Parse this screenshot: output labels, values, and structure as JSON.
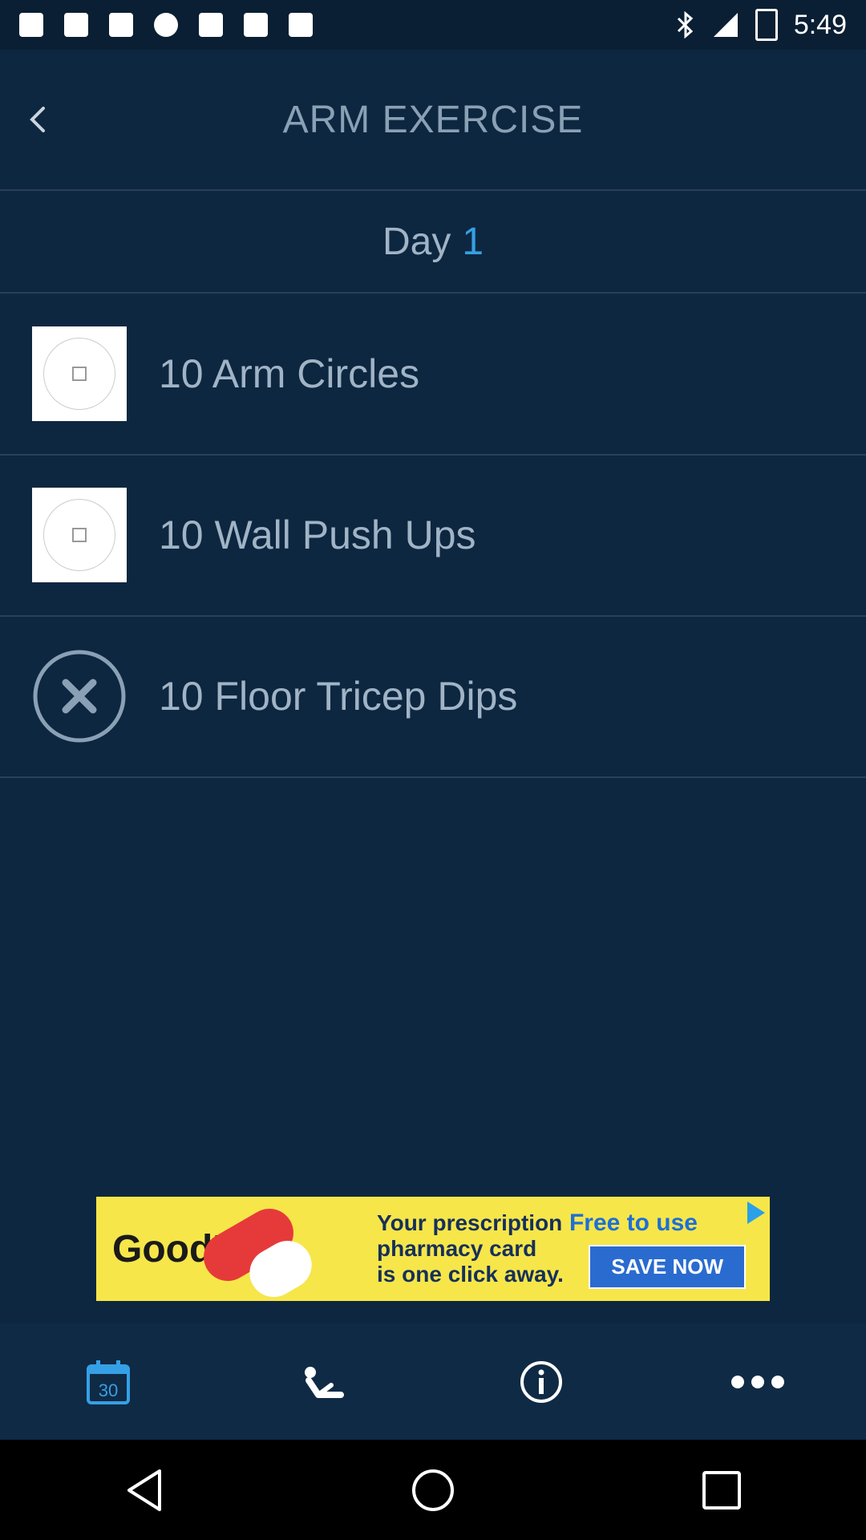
{
  "status_bar": {
    "time": "5:49"
  },
  "header": {
    "title": "ARM EXERCISE"
  },
  "day": {
    "label": "Day",
    "number": "1"
  },
  "exercises": [
    {
      "label": "10 Arm Circles",
      "status": "thumbnail"
    },
    {
      "label": "10 Wall Push Ups",
      "status": "thumbnail"
    },
    {
      "label": "10 Floor Tricep Dips",
      "status": "skipped"
    }
  ],
  "ad": {
    "brand": "GoodRx",
    "text_line1": "Your prescription",
    "text_line2": "pharmacy card",
    "text_line3": "is one click away.",
    "free": "Free to use",
    "cta": "SAVE NOW"
  },
  "bottom_nav": {
    "calendar_number": "30",
    "items": [
      "calendar-icon",
      "exercise-icon",
      "info-icon",
      "more-icon"
    ]
  },
  "colors": {
    "background": "#0e2740",
    "accent": "#35a0e6",
    "text_muted": "#a0b4c6"
  }
}
